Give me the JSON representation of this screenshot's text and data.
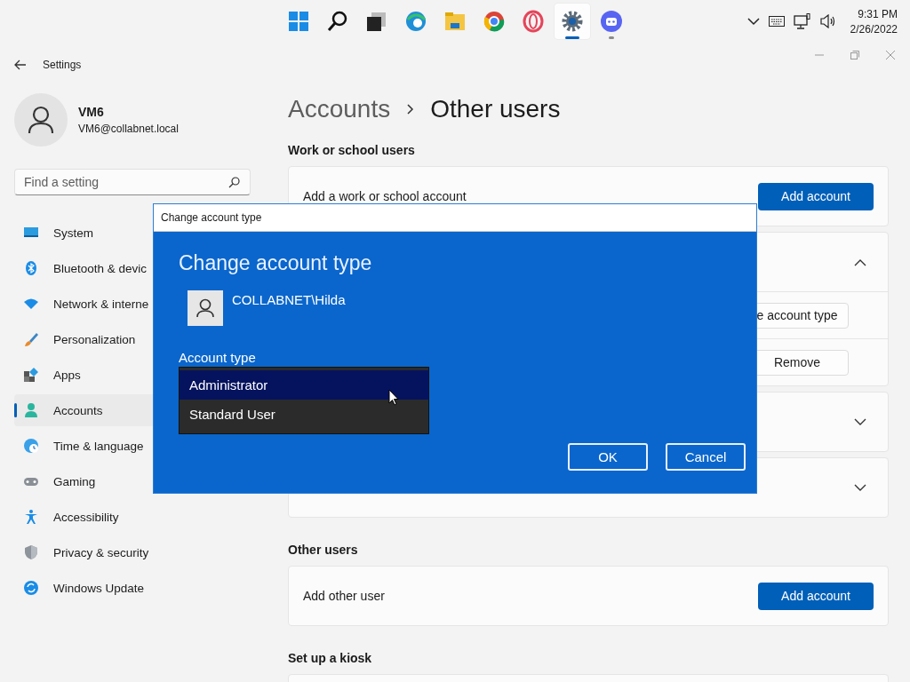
{
  "taskbar": {
    "apps": [
      {
        "selected": false,
        "running": false
      },
      {
        "selected": false,
        "running": false
      },
      {
        "selected": false,
        "running": false
      },
      {
        "selected": false,
        "running": false
      },
      {
        "selected": false,
        "running": false
      },
      {
        "selected": false,
        "running": false
      },
      {
        "selected": false,
        "running": false
      },
      {
        "selected": true,
        "running": true
      },
      {
        "selected": false,
        "running": true
      }
    ],
    "time": "9:31 PM",
    "date": "2/26/2022"
  },
  "window": {
    "title": "Settings"
  },
  "profile": {
    "name": "VM6",
    "email": "VM6@collabnet.local"
  },
  "search": {
    "placeholder": "Find a setting"
  },
  "nav": [
    {
      "label": "System",
      "selected": false
    },
    {
      "label": "Bluetooth & devic",
      "selected": false
    },
    {
      "label": "Network & interne",
      "selected": false
    },
    {
      "label": "Personalization",
      "selected": false
    },
    {
      "label": "Apps",
      "selected": false
    },
    {
      "label": "Accounts",
      "selected": true
    },
    {
      "label": "Time & language",
      "selected": false
    },
    {
      "label": "Gaming",
      "selected": false
    },
    {
      "label": "Accessibility",
      "selected": false
    },
    {
      "label": "Privacy & security",
      "selected": false
    },
    {
      "label": "Windows Update",
      "selected": false
    }
  ],
  "breadcrumb": {
    "parent": "Accounts",
    "current": "Other users"
  },
  "sections": [
    {
      "heading": "Work or school users",
      "cards": [
        {
          "kind": "action",
          "label": "Add a work or school account",
          "button": "Add account"
        },
        {
          "kind": "expander",
          "expanded": true,
          "rows": [
            "e account type",
            "Remove"
          ]
        },
        {
          "kind": "expander",
          "expanded": false
        },
        {
          "kind": "expander",
          "expanded": false
        }
      ]
    },
    {
      "heading": "Other users",
      "cards": [
        {
          "kind": "action",
          "label": "Add other user",
          "button": "Add account"
        }
      ]
    },
    {
      "heading": "Set up a kiosk",
      "cards": [
        {
          "kind": "blank"
        }
      ]
    }
  ],
  "dialog": {
    "title": "Change account type",
    "heading": "Change account type",
    "user": "COLLABNET\\Hilda",
    "field_label": "Account type",
    "options": [
      {
        "label": "Administrator",
        "selected": true
      },
      {
        "label": "Standard User",
        "selected": false
      }
    ],
    "buttons": [
      "OK",
      "Cancel"
    ]
  }
}
